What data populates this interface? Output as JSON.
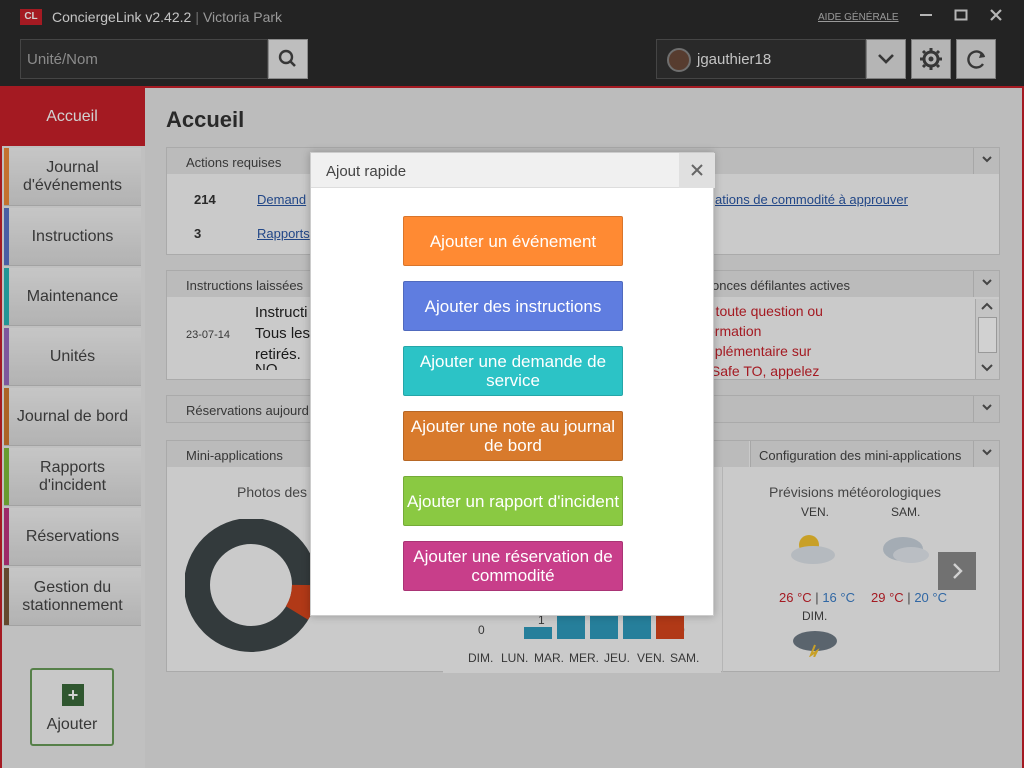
{
  "titlebar": {
    "logo": "CL",
    "app_name": "ConciergeLink v2.42.2",
    "separator": "|",
    "site": "Victoria Park",
    "help": "AIDE GÉNÉRALE",
    "min_icon": "minimize-icon",
    "max_icon": "maximize-icon",
    "close_icon": "close-icon"
  },
  "toolbar": {
    "search_placeholder": "Unité/Nom",
    "username": "jgauthier18"
  },
  "sidebar": {
    "active": "Accueil",
    "items": [
      {
        "label": "Journal d'événements",
        "color": "#f08a3a"
      },
      {
        "label": "Instructions",
        "color": "#5a73c8"
      },
      {
        "label": "Maintenance",
        "color": "#2ab7b7"
      },
      {
        "label": "Unités",
        "color": "#9a6bc0"
      },
      {
        "label": "Journal de bord",
        "color": "#d2792e"
      },
      {
        "label": "Rapports d'incident",
        "color": "#7fbf3a"
      },
      {
        "label": "Réservations",
        "color": "#c0347f"
      },
      {
        "label": "Gestion du stationnement",
        "color": "#7a5a3a"
      }
    ],
    "add_label": "Ajouter"
  },
  "main": {
    "page_title": "Accueil",
    "actions": {
      "title": "Actions requises",
      "rows": [
        {
          "count": "214",
          "link": "Demand",
          "link2": "ations de commodité à approuver"
        },
        {
          "count": "3",
          "link": "Rapports"
        }
      ]
    },
    "instructions": {
      "title": "Instructions laissées",
      "date": "23-07-14",
      "lines": [
        "Instructi",
        "Tous les",
        "retirés.",
        "NO MAN"
      ],
      "right_title": "onces défilantes actives",
      "right_lines": [
        "r toute question ou",
        "ormation",
        "nplémentaire sur",
        "tSafe TO, appelez"
      ]
    },
    "reservations": {
      "title": "Réservations aujourd"
    },
    "mini": {
      "title": "Mini-applications",
      "photos": "Photos des",
      "config": "Configuration des mini-applications"
    },
    "weather": {
      "title": "Prévisions météorologiques",
      "days": [
        "VEN.",
        "SAM.",
        "DIM."
      ],
      "hi": [
        "26 °C",
        "29 °C"
      ],
      "lo": [
        "16 °C",
        "20 °C"
      ],
      "sep": "|"
    },
    "week": {
      "days": [
        "DIM.",
        "LUN.",
        "MAR.",
        "MER.",
        "JEU.",
        "VEN.",
        "SAM."
      ],
      "values": [
        0,
        1,
        null,
        null,
        null,
        null,
        0
      ],
      "labels": [
        "0",
        "1",
        "0"
      ]
    }
  },
  "modal": {
    "title": "Ajout rapide",
    "buttons": [
      {
        "label": "Ajouter un événement",
        "color": "#ff8a33"
      },
      {
        "label": "Ajouter des instructions",
        "color": "#5f7de0"
      },
      {
        "label": "Ajouter une demande de service",
        "color": "#2cc3c6"
      },
      {
        "label": "Ajouter une note au journal de bord",
        "color": "#d87a2c"
      },
      {
        "label": "Ajouter un rapport d'incident",
        "color": "#8ac942"
      },
      {
        "label": "Ajouter une réservation de commodité",
        "color": "#c83e8a"
      }
    ]
  }
}
